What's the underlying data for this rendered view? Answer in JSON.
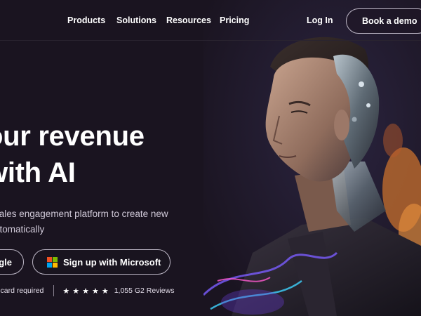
{
  "nav": {
    "items": [
      {
        "label": "Products"
      },
      {
        "label": "Solutions"
      },
      {
        "label": "Resources"
      },
      {
        "label": "Pricing"
      }
    ],
    "login_label": "Log In",
    "demo_label": "Book a demo"
  },
  "hero": {
    "headline_line1": "our revenue",
    "headline_line2": " with AI",
    "subtext_line1": "sales engagement platform to create new",
    "subtext_line2": "utomatically",
    "google_button_label": "gle",
    "microsoft_button_label": "Sign up with Microsoft",
    "footnote_left": "lit card required",
    "stars": "★★★★★",
    "reviews": "1,055 G2 Reviews"
  },
  "colors": {
    "background": "#1a1420",
    "text": "#ffffff",
    "button_border": "#bdb7c6",
    "ms_red": "#f25022",
    "ms_green": "#7fba00",
    "ms_blue": "#00a4ef",
    "ms_yellow": "#ffb900"
  },
  "icons": {
    "microsoft": "microsoft-logo-icon",
    "star": "star-icon"
  }
}
